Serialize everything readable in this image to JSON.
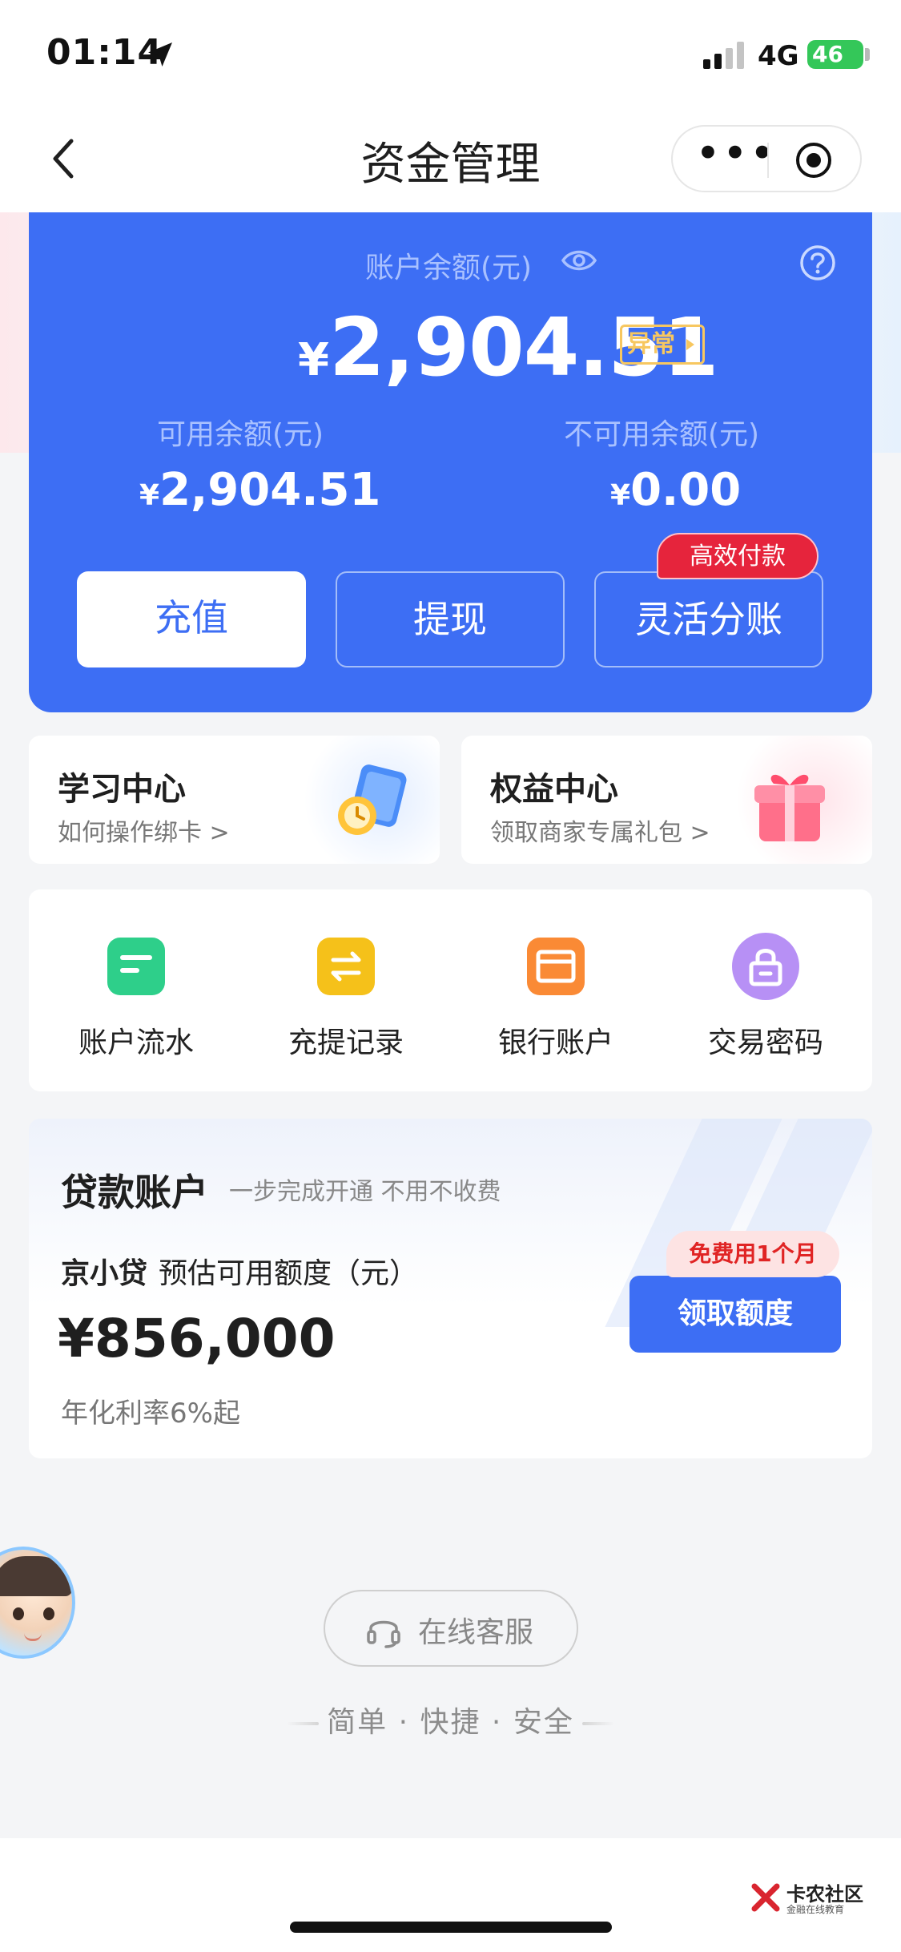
{
  "status_bar": {
    "time": "01:14",
    "network": "4G",
    "battery": "46"
  },
  "nav": {
    "title": "资金管理",
    "more": "•••"
  },
  "balance": {
    "label": "账户余额(元)",
    "currency": "¥",
    "amount": "2,904.51",
    "abnormal_badge": "异常",
    "available_label": "可用余额(元)",
    "available_amount": "2,904.51",
    "unavailable_label": "不可用余额(元)",
    "unavailable_amount": "0.00",
    "buttons": {
      "recharge": "充值",
      "withdraw": "提现",
      "split": "灵活分账"
    },
    "hot_badge": "高效付款"
  },
  "features": [
    {
      "title": "学习中心",
      "subtitle": "如何操作绑卡 >"
    },
    {
      "title": "权益中心",
      "subtitle": "领取商家专属礼包 >"
    }
  ],
  "menu": [
    {
      "label": "账户流水",
      "icon": "statement-icon",
      "color": "#2ecf8a"
    },
    {
      "label": "充提记录",
      "icon": "transfer-icon",
      "color": "#f5c11a"
    },
    {
      "label": "银行账户",
      "icon": "bank-card-icon",
      "color": "#fa8a35"
    },
    {
      "label": "交易密码",
      "icon": "lock-icon",
      "color": "#b790f5"
    }
  ],
  "loan": {
    "title": "贷款账户",
    "subtitle": "一步完成开通 不用不收费",
    "product": "京小贷",
    "quota_label": "预估可用额度（元）",
    "amount": "¥856,000",
    "rate": "年化利率6%起",
    "button": "领取额度",
    "badge": "免费用1个月"
  },
  "service": {
    "label": "在线客服"
  },
  "slogan": "简单 · 快捷 · 安全",
  "watermark": {
    "title": "卡农社区",
    "subtitle": "金融在线教育"
  },
  "colors": {
    "primary": "#3d6ef4",
    "badge_red": "#e6243c",
    "abnormal": "#f7c760"
  }
}
